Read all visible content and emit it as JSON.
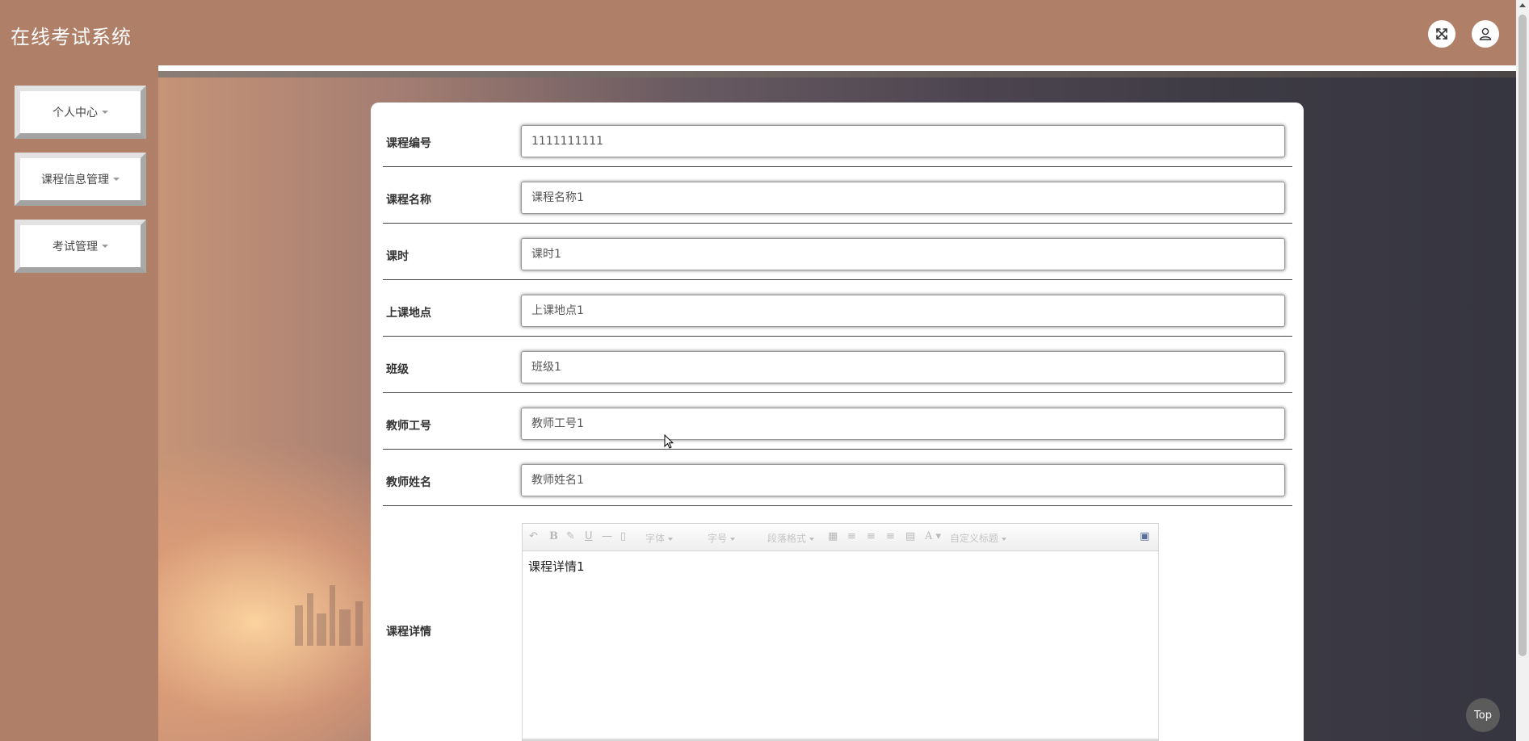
{
  "header": {
    "title": "在线考试系统",
    "fullscreen_icon": "expand-arrows-icon",
    "user_icon": "user-icon"
  },
  "sidebar": {
    "items": [
      {
        "label": "个人中心"
      },
      {
        "label": "课程信息管理"
      },
      {
        "label": "考试管理"
      }
    ]
  },
  "form": {
    "fields": [
      {
        "label": "课程编号",
        "value": "1111111111"
      },
      {
        "label": "课程名称",
        "value": "课程名称1"
      },
      {
        "label": "课时",
        "value": "课时1"
      },
      {
        "label": "上课地点",
        "value": "上课地点1"
      },
      {
        "label": "班级",
        "value": "班级1"
      },
      {
        "label": "教师工号",
        "value": "教师工号1"
      },
      {
        "label": "教师姓名",
        "value": "教师姓名1"
      }
    ],
    "detail": {
      "label": "课程详情",
      "content": "课程详情1"
    }
  },
  "editor_toolbar": {
    "font": "字体",
    "size": "字号",
    "paragraph": "段落格式",
    "custom_title": "自定义标题",
    "bold": "B",
    "underline": "U",
    "font_color": "A"
  },
  "top_button": "Top",
  "colors": {
    "header_bg": "#b07f68",
    "sidebar_bg": "#b07f68",
    "card_bg": "#ffffff",
    "top_btn_bg": "#5b5b5b"
  }
}
